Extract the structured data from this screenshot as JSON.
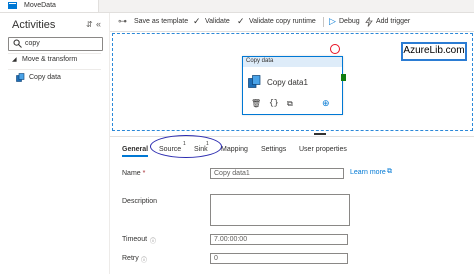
{
  "app": {
    "tab_title": "MoveData"
  },
  "activities": {
    "title": "Activities",
    "search_value": "copy",
    "section": "Move & transform",
    "items": [
      {
        "label": "Copy data"
      }
    ]
  },
  "toolbar": {
    "save_template": "Save as template",
    "validate": "Validate",
    "validate_runtime": "Validate copy runtime",
    "debug": "Debug",
    "add_trigger": "Add trigger"
  },
  "canvas": {
    "brand": "AzureLib.com",
    "node": {
      "type": "Copy data",
      "name": "Copy data1"
    }
  },
  "properties": {
    "tabs": [
      {
        "label": "General"
      },
      {
        "label": "Source",
        "badge": "1"
      },
      {
        "label": "Sink",
        "badge": "1"
      },
      {
        "label": "Mapping"
      },
      {
        "label": "Settings"
      },
      {
        "label": "User properties"
      }
    ],
    "name_label": "Name",
    "required_mark": "*",
    "name_value": "Copy data1",
    "learn_more": "Learn more",
    "description_label": "Description",
    "timeout_label": "Timeout",
    "timeout_value": "7.00:00:00",
    "retry_label": "Retry",
    "retry_value": "0"
  },
  "colors": {
    "accent": "#0078d4",
    "error": "#e81123",
    "success": "#107c10"
  }
}
